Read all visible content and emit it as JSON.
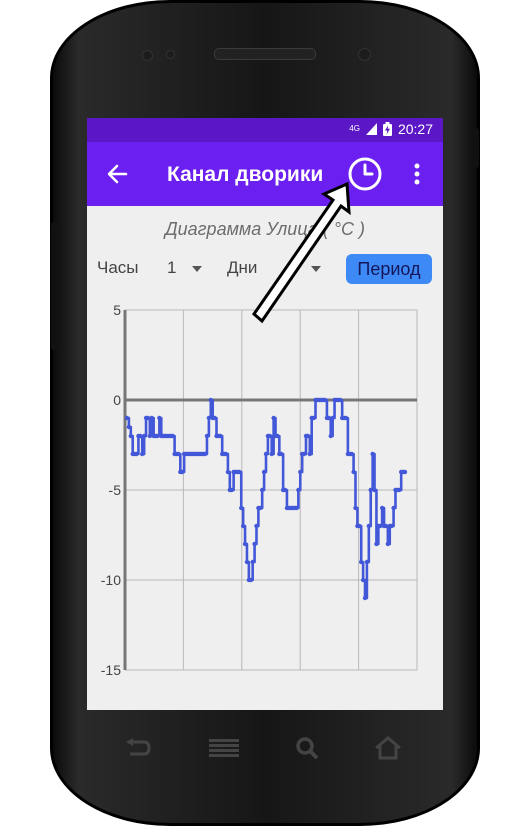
{
  "status_bar": {
    "network": "4G",
    "time": "20:27"
  },
  "app_bar": {
    "title": "Канал дворики",
    "icons": [
      "back-arrow-icon",
      "clock-icon",
      "more-vert-icon"
    ]
  },
  "diagram_title": "Диаграмма Улица ( °C )",
  "controls": {
    "hours_label": "Часы",
    "hours_value": "1",
    "days_label": "Дни",
    "period_button": "Период"
  },
  "nav_keys": [
    "back-nav-icon",
    "menu-nav-icon",
    "search-nav-icon",
    "home-nav-icon"
  ],
  "colors": {
    "status_bar": "#5b16c6",
    "app_bar": "#6b1ff0",
    "series": "#4358d8",
    "button": "#3d8af7"
  },
  "chart_data": {
    "type": "line",
    "title": "",
    "xlabel": "",
    "ylabel": "",
    "ylim": [
      -15,
      5
    ],
    "yticks": [
      "5",
      "0",
      "-5",
      "-10",
      "-15"
    ],
    "grid": true,
    "series": [
      {
        "values": [
          -1,
          -1.5,
          -2,
          -3,
          -3,
          -3,
          -2,
          -2,
          -3,
          -2,
          -1,
          -1,
          -2,
          -1,
          -2,
          -2,
          -2,
          -1,
          -2,
          -2,
          -2,
          -2,
          -2,
          -2,
          -2,
          -3,
          -3,
          -3,
          -4,
          -4,
          -3,
          -3,
          -3,
          -3,
          -3,
          -3,
          -3,
          -3,
          -3,
          -3,
          -3,
          -3,
          -2,
          -1,
          0,
          -1,
          -1,
          -2,
          -2,
          -2,
          -3,
          -3,
          -3,
          -4,
          -5,
          -5,
          -4,
          -4,
          -4,
          -4,
          -6,
          -7,
          -8,
          -9,
          -10,
          -10,
          -9,
          -8,
          -7,
          -6,
          -6,
          -5,
          -4,
          -3,
          -2,
          -2,
          -3,
          -1,
          -2,
          -2,
          -3,
          -3,
          -5,
          -5,
          -6,
          -6,
          -6,
          -6,
          -6,
          -6,
          -5,
          -4,
          -3,
          -3,
          -2,
          -2,
          -3,
          -1,
          -1,
          0,
          0,
          0,
          0,
          0,
          0,
          -1,
          -1,
          -2,
          -1,
          0,
          0,
          0,
          0,
          -1,
          -1,
          -1,
          -3,
          -3,
          -3,
          -4,
          -6,
          -7,
          -7,
          -9,
          -10,
          -11,
          -9,
          -7,
          -5,
          -3,
          -5,
          -8,
          -7,
          -7,
          -6,
          -7,
          -7,
          -8,
          -7,
          -7,
          -6,
          -5,
          -5,
          -5,
          -4,
          -4,
          -4
        ]
      }
    ]
  }
}
